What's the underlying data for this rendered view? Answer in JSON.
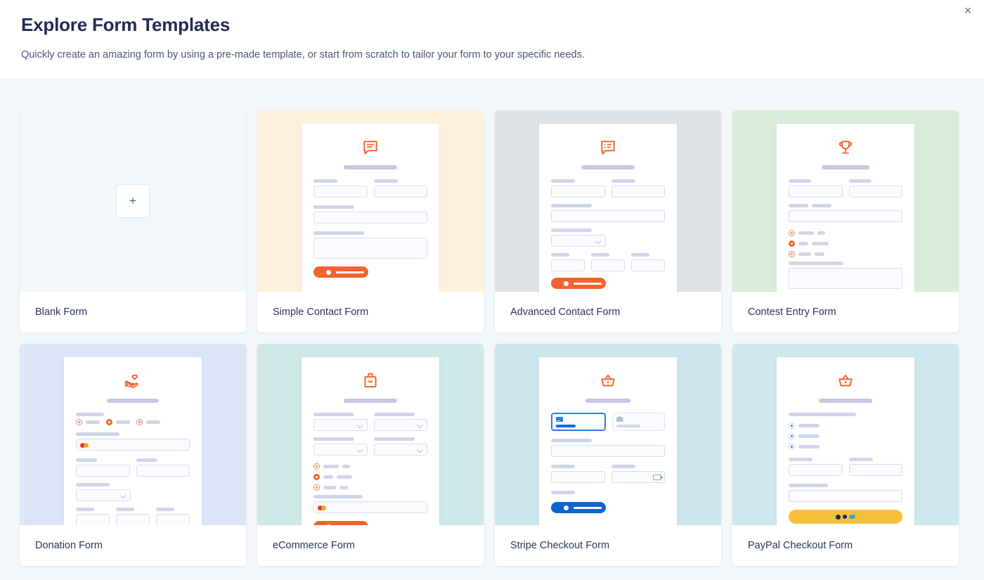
{
  "header": {
    "title": "Explore Form Templates",
    "subtitle": "Quickly create an amazing form by using a pre-made template, or start from scratch to tailor your form to your specific needs.",
    "close_label": "×",
    "close_icon": "close-icon"
  },
  "colors": {
    "page_background": "#f4f7fa",
    "title": "#232c52",
    "accent_orange": "#f4622e",
    "accent_blue": "#0a65d0",
    "paypal_yellow": "#f9bf3b",
    "skeleton": "#d2d5e9"
  },
  "templates": [
    {
      "label": "Blank Form",
      "type": "blank",
      "thumb_background": "#f3f7fa",
      "icon": "plus-icon",
      "plus_glyph": "+"
    },
    {
      "label": "Simple Contact Form",
      "type": "preview",
      "thumb_background": "#fdf0da",
      "icon": "speech-bubble-icon",
      "button_color": "#f4622e"
    },
    {
      "label": "Advanced Contact Form",
      "type": "preview",
      "thumb_background": "#dfe2e5",
      "icon": "speech-bubble-list-icon",
      "button_color": "#f4622e"
    },
    {
      "label": "Contest Entry Form",
      "type": "preview",
      "thumb_background": "#d9edda",
      "icon": "trophy-icon",
      "button_color": "#f4622e"
    },
    {
      "label": "Donation Form",
      "type": "preview",
      "thumb_background": "#dde5f8",
      "icon": "hand-heart-icon",
      "button_color": "#f4622e"
    },
    {
      "label": "eCommerce Form",
      "type": "preview",
      "thumb_background": "#cfe9e8",
      "icon": "shopping-bag-icon",
      "button_color": "#f4622e"
    },
    {
      "label": "Stripe Checkout Form",
      "type": "preview",
      "thumb_background": "#cbe6ec",
      "icon": "shopping-basket-icon",
      "button_color": "#0a65d0"
    },
    {
      "label": "PayPal Checkout Form",
      "type": "preview",
      "thumb_background": "#cfe8ee",
      "icon": "shopping-basket-icon",
      "button_color": "#f9bf3b"
    }
  ]
}
